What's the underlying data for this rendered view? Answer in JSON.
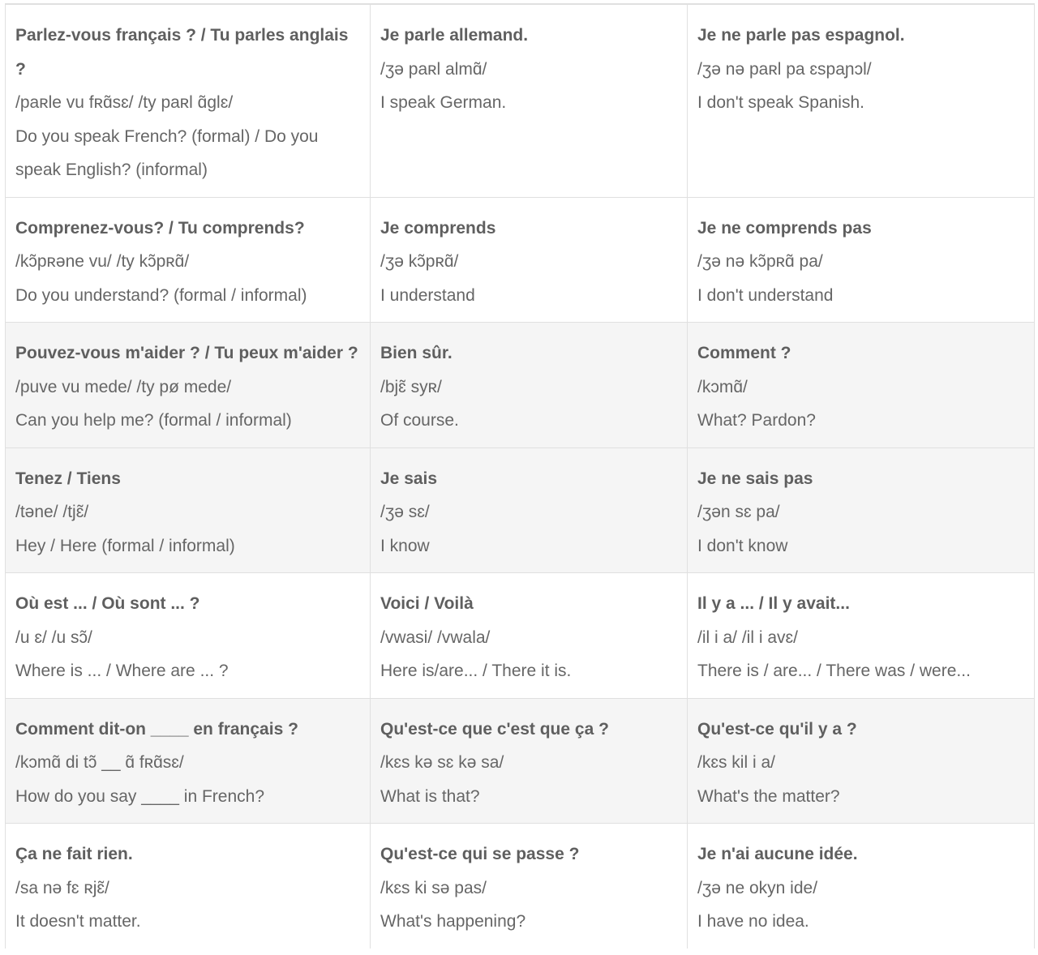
{
  "rows": [
    [
      {
        "french": "Parlez-vous français ? / Tu parles anglais ?",
        "ipa": "/paʀle vu fʀɑ̃sɛ/ /ty paʀl ɑ̃glɛ/",
        "english": "Do you speak French? (formal) / Do you speak English? (informal)"
      },
      {
        "french": "Je parle allemand.",
        "ipa": "/ʒə paʀl almɑ̃/",
        "english": "I speak German."
      },
      {
        "french": "Je ne parle pas espagnol.",
        "ipa": "/ʒə nə paʀl pa ɛspaɲɔl/",
        "english": "I don't speak Spanish."
      }
    ],
    [
      {
        "french": "Comprenez-vous? / Tu comprends?",
        "ipa": "/kɔ̃pʀəne vu/ /ty kɔ̃pʀɑ̃/",
        "english": "Do you understand? (formal / informal)"
      },
      {
        "french": "Je comprends",
        "ipa": "/ʒə kɔ̃pʀɑ̃/",
        "english": "I understand"
      },
      {
        "french": "Je ne comprends pas",
        "ipa": "/ʒə nə kɔ̃pʀɑ̃ pa/",
        "english": "I don't understand"
      }
    ],
    [
      {
        "french": "Pouvez-vous m'aider ? / Tu peux m'aider ?",
        "ipa": "/puve vu mede/ /ty pø mede/",
        "english": "Can you help me? (formal / informal)"
      },
      {
        "french": "Bien sûr.",
        "ipa": "/bjɛ̃ syʀ/",
        "english": "Of course."
      },
      {
        "french": "Comment ?",
        "ipa": "/kɔmɑ̃/",
        "english": "What? Pardon?"
      }
    ],
    [
      {
        "french": "Tenez / Tiens",
        "ipa": "/təne/ /tjɛ̃/",
        "english": "Hey / Here (formal / informal)"
      },
      {
        "french": "Je sais",
        "ipa": "/ʒə sɛ/",
        "english": "I know"
      },
      {
        "french": "Je ne sais pas",
        "ipa": "/ʒən sɛ pa/",
        "english": "I don't know"
      }
    ],
    [
      {
        "french": "Où est ... / Où sont ... ?",
        "ipa": "/u ɛ/ /u sɔ̃/",
        "english": "Where is ... / Where are ... ?"
      },
      {
        "french": "Voici / Voilà",
        "ipa": "/vwasi/ /vwala/",
        "english": "Here is/are... / There it is."
      },
      {
        "french": "Il y a ... / Il y avait...",
        "ipa": "/il i a/ /il i avɛ/",
        "english": "There is / are... / There was / were..."
      }
    ],
    [
      {
        "french": "Comment dit-on ____ en français ?",
        "ipa": "/kɔmɑ̃ di tɔ̃ __ ɑ̃ fʀɑ̃sɛ/",
        "english": "How do you say ____ in French?"
      },
      {
        "french": "Qu'est-ce que c'est que ça ?",
        "ipa": "/kɛs kə sɛ kə sa/",
        "english": "What is that?"
      },
      {
        "french": "Qu'est-ce qu'il y a ?",
        "ipa": "/kɛs kil i a/",
        "english": "What's the matter?"
      }
    ],
    [
      {
        "french": "Ça ne fait rien.",
        "ipa": "/sa nə fɛ ʀjɛ̃/",
        "english": "It doesn't matter."
      },
      {
        "french": "Qu'est-ce qui se passe ?",
        "ipa": "/kɛs ki sə pas/",
        "english": "What's happening?"
      },
      {
        "french": "Je n'ai aucune idée.",
        "ipa": "/ʒə ne okyn ide/",
        "english": "I have no idea."
      }
    ]
  ]
}
